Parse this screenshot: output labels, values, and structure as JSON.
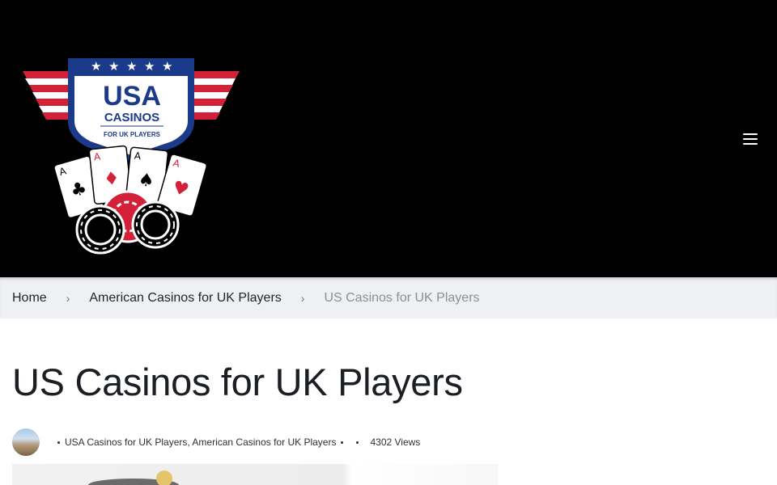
{
  "header": {
    "logo": {
      "line1": "USA",
      "line2": "CASINOS",
      "line3": "FOR UK PLAYERS",
      "colors": {
        "navy": "#1b3a8a",
        "red": "#d4213a",
        "white": "#ffffff"
      }
    },
    "menu_icon": "hamburger-menu-icon"
  },
  "breadcrumb": {
    "items": [
      {
        "label": "Home"
      },
      {
        "label": "American Casinos for UK Players"
      }
    ],
    "current": "US Casinos for UK Players",
    "separator": "›"
  },
  "article": {
    "title": "US Casinos for UK Players",
    "categories": "USA Casinos for UK Players, American Casinos for UK Players",
    "views": "4302 Views"
  },
  "colors": {
    "header_bg": "#000000",
    "breadcrumb_bg": "#eef0f3",
    "text": "#1f2328",
    "muted": "#8a9098"
  }
}
